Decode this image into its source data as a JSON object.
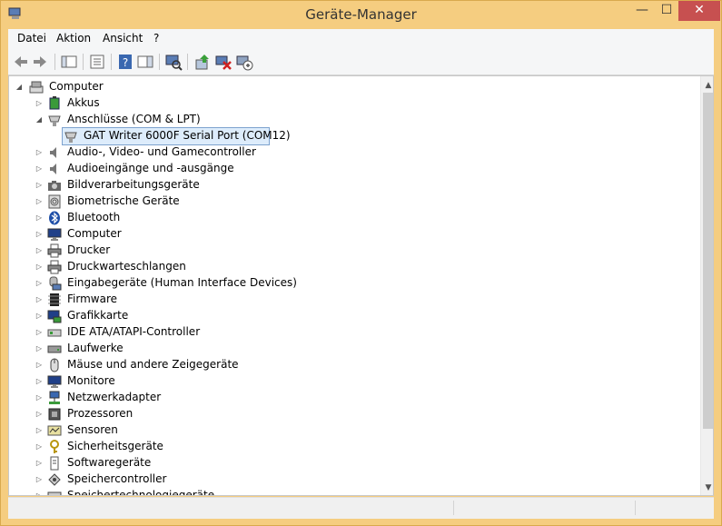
{
  "window": {
    "title": "Geräte-Manager",
    "controls": {
      "minimize": "—",
      "maximize": "☐",
      "close": "✕"
    }
  },
  "menu": [
    "Datei",
    "Aktion",
    "Ansicht",
    "?"
  ],
  "toolbar": {
    "icons": [
      "back-icon",
      "forward-icon",
      "show-hide-console-tree-icon",
      "properties-icon",
      "help-icon",
      "show-action-pane-icon",
      "scan-hardware-icon",
      "update-driver-icon",
      "uninstall-device-icon",
      "enable-device-icon"
    ]
  },
  "tree": {
    "root": "Computer",
    "items": [
      {
        "label": "Akkus",
        "icon": "battery-icon"
      },
      {
        "label": "Anschlüsse (COM & LPT)",
        "icon": "port-icon",
        "expanded": true,
        "children": [
          {
            "label": "GAT Writer 6000F Serial Port (COM12)",
            "icon": "port-icon",
            "selected": true
          }
        ]
      },
      {
        "label": "Audio-, Video- und Gamecontroller",
        "icon": "speaker-icon"
      },
      {
        "label": "Audioeingänge und -ausgänge",
        "icon": "speaker-icon"
      },
      {
        "label": "Bildverarbeitungsgeräte",
        "icon": "camera-icon"
      },
      {
        "label": "Biometrische Geräte",
        "icon": "fingerprint-icon"
      },
      {
        "label": "Bluetooth",
        "icon": "bluetooth-icon"
      },
      {
        "label": "Computer",
        "icon": "monitor-icon"
      },
      {
        "label": "Drucker",
        "icon": "printer-icon"
      },
      {
        "label": "Druckwarteschlangen",
        "icon": "printer-icon"
      },
      {
        "label": "Eingabegeräte (Human Interface Devices)",
        "icon": "hid-icon"
      },
      {
        "label": "Firmware",
        "icon": "chip-icon"
      },
      {
        "label": "Grafikkarte",
        "icon": "display-adapter-icon"
      },
      {
        "label": "IDE ATA/ATAPI-Controller",
        "icon": "ide-icon"
      },
      {
        "label": "Laufwerke",
        "icon": "disk-drive-icon"
      },
      {
        "label": "Mäuse und andere Zeigegeräte",
        "icon": "mouse-icon"
      },
      {
        "label": "Monitore",
        "icon": "monitor-icon"
      },
      {
        "label": "Netzwerkadapter",
        "icon": "network-icon"
      },
      {
        "label": "Prozessoren",
        "icon": "processor-icon"
      },
      {
        "label": "Sensoren",
        "icon": "sensor-icon"
      },
      {
        "label": "Sicherheitsgeräte",
        "icon": "key-icon"
      },
      {
        "label": "Softwaregeräte",
        "icon": "software-device-icon"
      },
      {
        "label": "Speichercontroller",
        "icon": "storage-controller-icon"
      },
      {
        "label": "Speichertechnologiegeräte",
        "icon": "memory-tech-icon"
      }
    ]
  },
  "colors": {
    "frame": "#f5cd80",
    "close": "#c75050",
    "selection": "#ddecfb",
    "selection_border": "#7da2ce"
  }
}
